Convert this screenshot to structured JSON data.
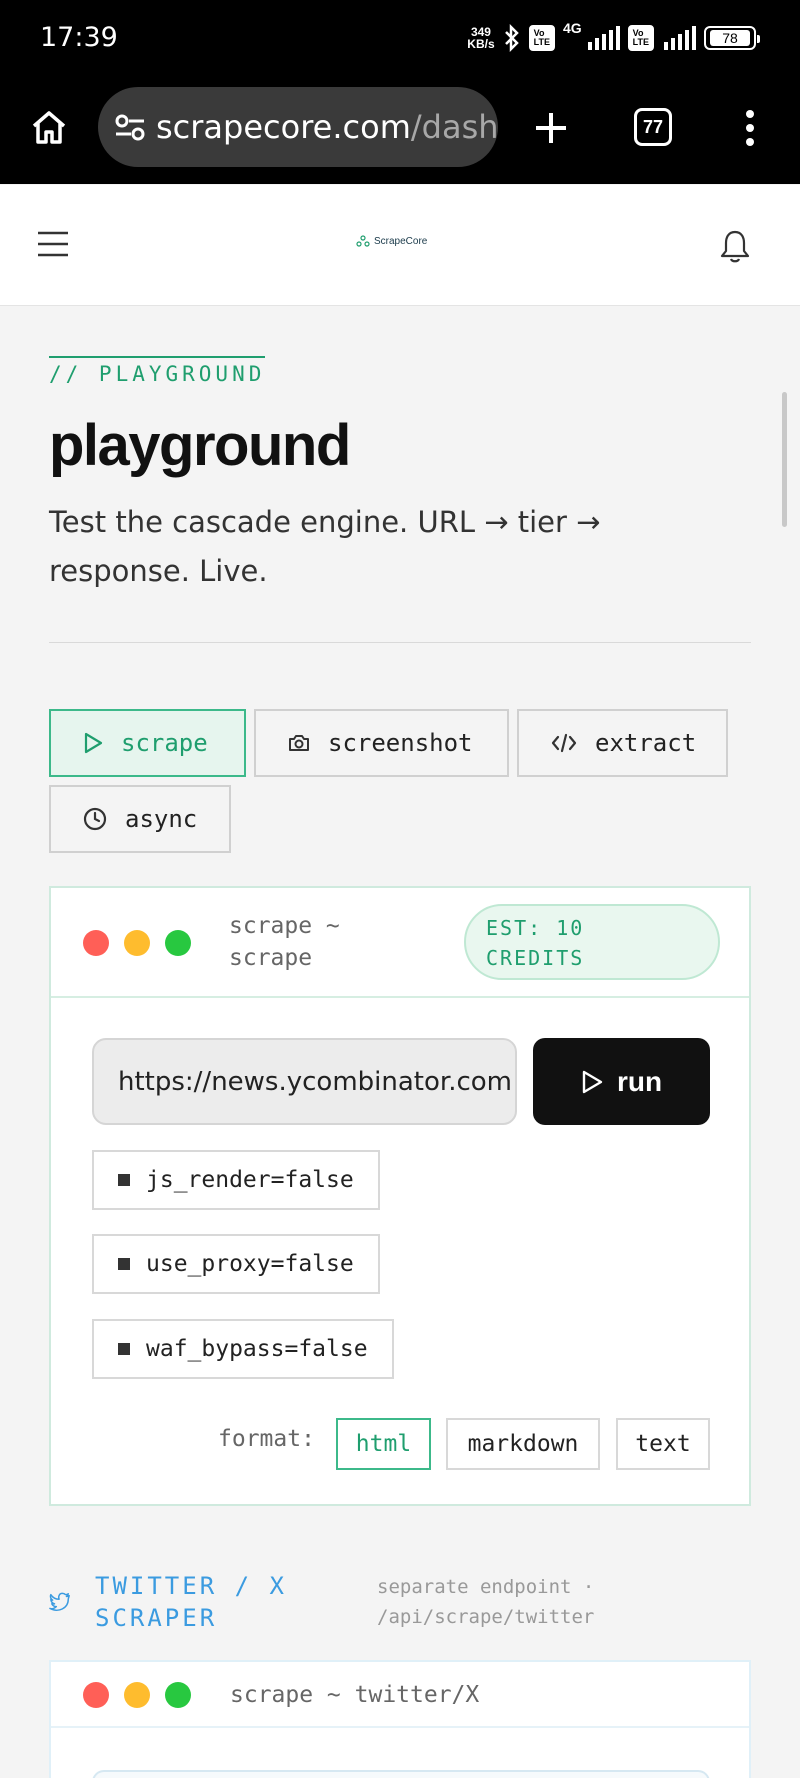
{
  "status_bar": {
    "time": "17:39",
    "net_speed_value": "349",
    "net_speed_unit": "KB/s",
    "signal_label": "4G",
    "volte_label": "Vo LTE",
    "battery": "78"
  },
  "browser": {
    "url_host": "scrapecore.com",
    "url_path": "/dash",
    "tab_count": "77"
  },
  "app_header": {
    "logo_text": "ScrapeCore"
  },
  "page": {
    "eyebrow": "// PLAYGROUND",
    "title": "playground",
    "subtitle": "Test the cascade engine. URL → tier → response. Live."
  },
  "modes": [
    {
      "label": "scrape",
      "icon": "play-icon",
      "active": true
    },
    {
      "label": "screenshot",
      "icon": "camera-icon",
      "active": false
    },
    {
      "label": "extract",
      "icon": "code-icon",
      "active": false
    },
    {
      "label": "async",
      "icon": "clock-icon",
      "active": false
    }
  ],
  "scrape_card": {
    "title_line1": "scrape ~",
    "title_line2": "scrape",
    "credits_line1": "EST: 10",
    "credits_line2": "CREDITS",
    "url_value": "https://news.ycombinator.com",
    "run_label": "run",
    "options": [
      "js_render=false",
      "use_proxy=false",
      "waf_bypass=false"
    ],
    "format_label": "format:",
    "formats": [
      "html",
      "markdown",
      "text"
    ],
    "active_format": "html"
  },
  "twitter_section": {
    "label_line1": "TWITTER / X",
    "label_line2": "SCRAPER",
    "note_line1": "separate endpoint ·",
    "note_line2": "/api/scrape/twitter",
    "card_title": "scrape ~ twitter/X"
  },
  "colors": {
    "accent": "#1f9e6e",
    "dot_red": "#ff5f57",
    "dot_yellow": "#febc2e",
    "dot_green": "#28c840",
    "twitter_blue": "#3b9be0"
  }
}
